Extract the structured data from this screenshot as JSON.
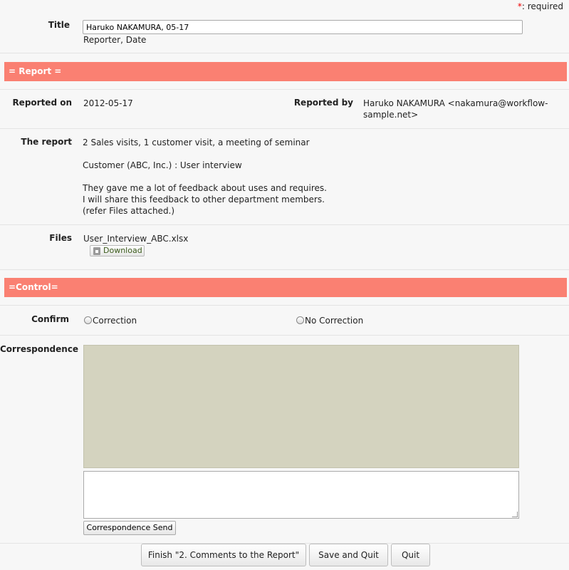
{
  "required_note": {
    "star": "*",
    "text": ": required"
  },
  "title_row": {
    "label": "Title",
    "value": "Haruko NAKAMURA, 05-17",
    "hint": "Reporter, Date"
  },
  "report_section": {
    "header": "= Report ="
  },
  "reported_on": {
    "label": "Reported on",
    "value": "2012-05-17"
  },
  "reported_by": {
    "label": "Reported by",
    "line1": "Haruko NAKAMURA <nakamura@workflow-",
    "line2": "sample.net>"
  },
  "the_report": {
    "label": "The report",
    "lines": [
      "2 Sales visits, 1 customer visit, a meeting of seminar",
      "Customer (ABC, Inc.) : User interview",
      "They gave me a lot of feedback about uses and requires.",
      "I will share this feedback to other department members.",
      "(refer Files attached.)"
    ]
  },
  "files": {
    "label": "Files",
    "filename": "User_Interview_ABC.xlsx",
    "download_label": "Download"
  },
  "control_section": {
    "header": "=Control="
  },
  "confirm": {
    "label": "Confirm",
    "options": [
      "Correction",
      "No Correction"
    ]
  },
  "correspondence": {
    "label": "Correspondence",
    "send_label": "Correspondence Send"
  },
  "footer": {
    "finish_label": "Finish \"2. Comments to the Report\"",
    "save_label": "Save and Quit",
    "quit_label": "Quit"
  },
  "colors": {
    "section_header": "#fa8072",
    "correspondence_bg": "#d4d3bf"
  },
  "icons": {
    "download": "file-download-icon"
  }
}
